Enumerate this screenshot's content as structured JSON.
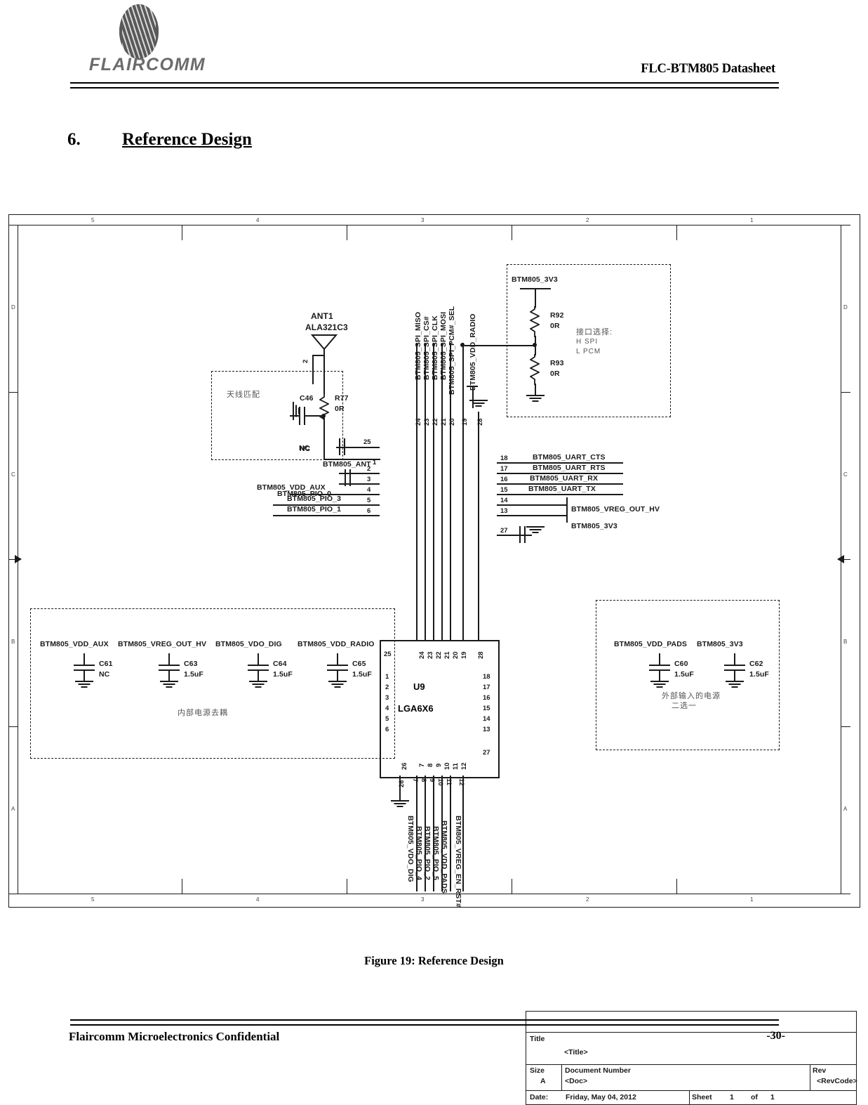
{
  "header": {
    "logo_text": "FLAIRCOMM",
    "doc_title": "FLC-BTM805 Datasheet"
  },
  "section": {
    "number": "6.",
    "title": "Reference Design"
  },
  "figure": {
    "caption": "Figure 19: Reference Design"
  },
  "footer": {
    "confidential": "Flaircomm Microelectronics Confidential",
    "page": "-30-"
  },
  "schematic": {
    "zones_top": [
      "5",
      "4",
      "3",
      "2",
      "1"
    ],
    "zones_bottom": [
      "5",
      "4",
      "3",
      "2",
      "1"
    ],
    "zones_left": [
      "D",
      "C",
      "B",
      "A"
    ],
    "zones_right": [
      "D",
      "C",
      "B",
      "A"
    ],
    "ic": {
      "designator": "U9",
      "package": "LGA6X6"
    },
    "antenna": {
      "designator": "ANT1",
      "part": "ALA321C3",
      "pin": "2"
    },
    "matching_box": {
      "note_cn": "天线匹配",
      "resistor": {
        "designator": "R77",
        "value": "0R"
      },
      "capacitor": {
        "designator": "C46",
        "value": "NC"
      }
    },
    "interface_select_box": {
      "rail": "BTM805_3V3",
      "r_top": {
        "designator": "R92",
        "value": "0R"
      },
      "r_bottom": {
        "designator": "R93",
        "value": "0R"
      },
      "note_title": "接口选择:",
      "note_high": "H  SPI",
      "note_low": "L  PCM"
    },
    "internal_decoupling_box": {
      "note_cn": "内部电源去耦",
      "caps": [
        {
          "net": "BTM805_VDD_AUX",
          "designator": "C61",
          "value": "NC"
        },
        {
          "net": "BTM805_VREG_OUT_HV",
          "designator": "C63",
          "value": "1.5uF"
        },
        {
          "net": "BTM805_VDO_DIG",
          "designator": "C64",
          "value": "1.5uF"
        },
        {
          "net": "BTM805_VDD_RADIO",
          "designator": "C65",
          "value": "1.5uF"
        }
      ]
    },
    "external_power_box": {
      "note_cn_1": "外部输入的电源",
      "note_cn_2": "二选一",
      "caps": [
        {
          "net": "BTM805_VDD_PADS",
          "designator": "C60",
          "value": "1.5uF"
        },
        {
          "net": "BTM805_3V3",
          "designator": "C62",
          "value": "1.5uF"
        }
      ]
    },
    "pins_left": [
      {
        "num": "25",
        "net": ""
      },
      {
        "num": "1",
        "net": "BTM805_ANT"
      },
      {
        "num": "2",
        "net": ""
      },
      {
        "num": "3",
        "net": ""
      },
      {
        "num": "4",
        "net": "BTM805_VDD_AUX"
      },
      {
        "num": "5",
        "net": "BTM805_PIO_3"
      },
      {
        "num": "6",
        "net": "BTM805_PIO_1"
      }
    ],
    "pins_left_extra": [
      {
        "net": "BTM805_PIO_0"
      }
    ],
    "pins_right": [
      {
        "num": "18",
        "net": "BTM805_UART_CTS"
      },
      {
        "num": "17",
        "net": "BTM805_UART_RTS"
      },
      {
        "num": "16",
        "net": "BTM805_UART_RX"
      },
      {
        "num": "15",
        "net": "BTM805_UART_TX"
      },
      {
        "num": "14",
        "net": "BTM805_VREG_OUT_HV"
      },
      {
        "num": "13",
        "net": "BTM805_3V3"
      },
      {
        "num": "27",
        "net": ""
      }
    ],
    "pins_top": [
      {
        "num": "24",
        "net": "BTM805_SPI_MISO"
      },
      {
        "num": "23",
        "net": "BTM805_SPI_CS#"
      },
      {
        "num": "22",
        "net": "BTM805_SPI_CLK"
      },
      {
        "num": "21",
        "net": "BTM805_SPI_MOSI"
      },
      {
        "num": "20",
        "net": "BTM805_SPI_PCM#_SEL"
      },
      {
        "num": "19",
        "net": "BTM805_VDD_RADIO"
      },
      {
        "num": "28",
        "net": ""
      }
    ],
    "pins_bottom": [
      {
        "num": "26",
        "net": ""
      },
      {
        "num": "7",
        "net": "BTM805_VDO_DIG"
      },
      {
        "num": "8",
        "net": "BTM805_PIO_4"
      },
      {
        "num": "9",
        "net": "BTM805_PIO_2"
      },
      {
        "num": "10",
        "net": "BTM805_PIO_5"
      },
      {
        "num": "11",
        "net": "BTM805_VDD_PADS"
      },
      {
        "num": "12",
        "net": "BTM805_VREG_EN_RST#"
      }
    ],
    "nc_label": "NC",
    "title_block": {
      "title_label": "Title",
      "title_value": "<Title>",
      "size_label": "Size",
      "size_value": "A",
      "docnum_label": "Document Number",
      "docnum_value": "<Doc>",
      "rev_label": "Rev",
      "rev_value": "<RevCode>",
      "date_label": "Date:",
      "date_value": "Friday, May 04, 2012",
      "sheet_label": "Sheet",
      "sheet_num": "1",
      "sheet_of": "of",
      "sheet_total": "1"
    }
  }
}
